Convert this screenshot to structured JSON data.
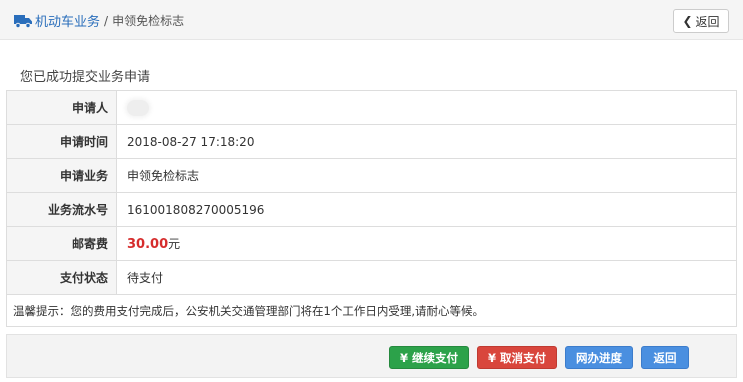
{
  "breadcrumb": {
    "icon": "truck-icon",
    "parent": "机动车业务",
    "separator": "/",
    "current": "申领免检标志"
  },
  "back_top": {
    "icon": "chevron-left-icon",
    "label": "返回"
  },
  "success_message": "您已成功提交业务申请",
  "table": {
    "applicant_label": "申请人",
    "applicant_value": "",
    "time_label": "申请时间",
    "time_value": "2018-08-27 17:18:20",
    "business_label": "申请业务",
    "business_value": "申领免检标志",
    "serial_label": "业务流水号",
    "serial_value": "161001808270005196",
    "postage_label": "邮寄费",
    "postage_amount": "30.00",
    "postage_unit": "元",
    "pay_status_label": "支付状态",
    "pay_status_value": "待支付",
    "notice": "温馨提示：您的费用支付完成后，公安机关交通管理部门将在1个工作日内受理,请耐心等候。"
  },
  "buttons": {
    "continue_pay": "¥ 继续支付",
    "cancel_pay": "¥ 取消支付",
    "progress": "网办进度",
    "back": "返回"
  },
  "colors": {
    "link_blue": "#2a6ebb",
    "fee_red": "#d62d2d",
    "btn_green": "#2ca24a",
    "btn_red": "#d9463c",
    "btn_blue": "#4a8fe0"
  }
}
